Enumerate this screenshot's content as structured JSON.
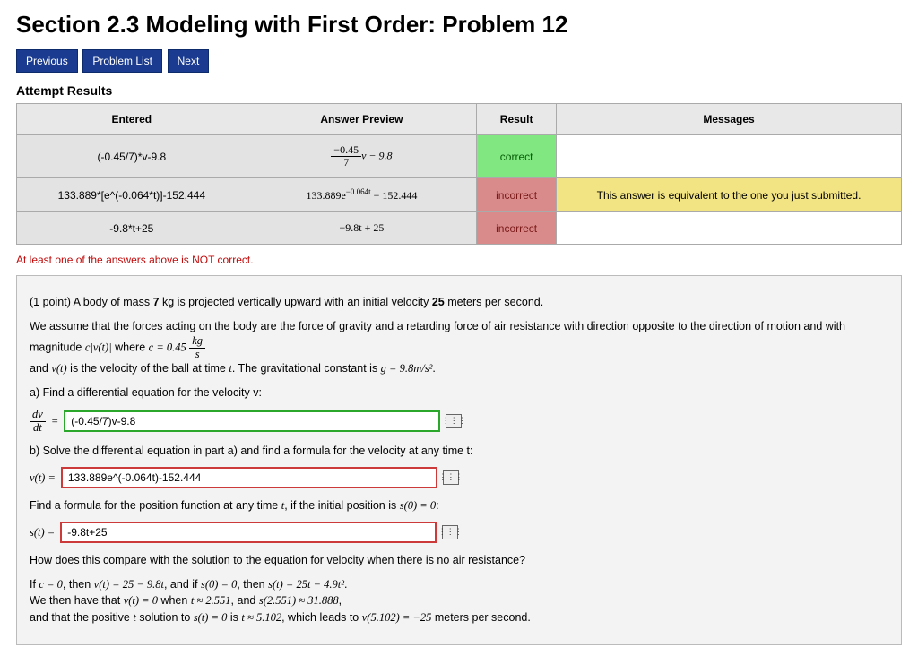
{
  "page_title": "Section 2.3 Modeling with First Order: Problem 12",
  "nav": {
    "prev": "Previous",
    "list": "Problem List",
    "next": "Next"
  },
  "attempt_heading": "Attempt Results",
  "table": {
    "headers": {
      "entered": "Entered",
      "preview": "Answer Preview",
      "result": "Result",
      "messages": "Messages"
    },
    "rows": [
      {
        "entered": "(-0.45/7)*v-9.8",
        "preview_num": "−0.45",
        "preview_den": "7",
        "preview_tail": "v − 9.8",
        "result": "correct",
        "result_class": "res-correct",
        "message": ""
      },
      {
        "entered": "133.889*[e^(-0.064*t)]-152.444",
        "preview_plain": "133.889e",
        "preview_sup": "−0.064t",
        "preview_tail2": " − 152.444",
        "result": "incorrect",
        "result_class": "res-incorrect",
        "message": "This answer is equivalent to the one you just submitted.",
        "msg_class": "msg-warn"
      },
      {
        "entered": "-9.8*t+25",
        "preview_plain2": "−9.8t + 25",
        "result": "incorrect",
        "result_class": "res-incorrect",
        "message": ""
      }
    ]
  },
  "not_correct": "At least one of the answers above is NOT correct.",
  "problem": {
    "points_lead": "(1 point) A body of mass ",
    "mass": "7",
    "points_mid": " kg is projected vertically upward with an initial velocity ",
    "v0": "25",
    "points_tail": " meters per second.",
    "assume_pre": "We assume that the forces acting on the body are the force of gravity and a retarding force of air resistance with direction opposite to the direction of motion and with magnitude ",
    "assume_cvt": "c|v(t)|",
    "assume_where": " where ",
    "assume_cval": "c = 0.45",
    "assume_unit_num": "kg",
    "assume_unit_den": "s",
    "assume_line2a": "and ",
    "assume_vt": "v(t)",
    "assume_line2b": " is the velocity of the ball at time ",
    "assume_t": "t",
    "assume_line2c": ". The gravitational constant is ",
    "assume_g": "g = 9.8m/s²",
    "assume_line2d": ".",
    "a_prompt": "a) Find a differential equation for the velocity v:",
    "a_lhs_num": "dv",
    "a_lhs_den": "dt",
    "a_eq": "=",
    "a_value": "(-0.45/7)v-9.8",
    "b_prompt": "b) Solve the differential equation in part a) and find a formula for the velocity at any time t:",
    "b_lhs": "v(t) =",
    "b_value": "133.889e^(-0.064t)-152.444",
    "c_prompt_pre": "Find a formula for the position function at any time ",
    "c_prompt_mid": ", if the initial position is ",
    "c_prompt_cond": "s(0) = 0",
    "c_prompt_tail": ":",
    "c_lhs": "s(t) =",
    "c_value": "-9.8t+25",
    "compare": "How does this compare with the solution to the equation for velocity when there is no air resistance?",
    "sol1_a": "If ",
    "sol1_c0": "c = 0",
    "sol1_b": ", then ",
    "sol1_vt": "v(t) = 25 − 9.8t",
    "sol1_c": ", and if ",
    "sol1_s0": "s(0) = 0",
    "sol1_d": ", then ",
    "sol1_st": "s(t) = 25t − 4.9t²",
    "sol1_e": ".",
    "sol2_a": "We then have that ",
    "sol2_vt0": "v(t) = 0",
    "sol2_b": " when ",
    "sol2_t1": "t ≈ 2.551",
    "sol2_c": ", and ",
    "sol2_s1": "s(2.551) ≈ 31.888",
    "sol2_d": ",",
    "sol3_a": "and that the positive ",
    "sol3_t": "t",
    "sol3_b": " solution to ",
    "sol3_st0": "s(t) = 0",
    "sol3_c": " is ",
    "sol3_t2": "t ≈ 5.102",
    "sol3_d": ", which leads to ",
    "sol3_v2": "v(5.102) = −25",
    "sol3_e": " meters per second."
  },
  "chart_data": {
    "type": "table",
    "title": "Attempt Results",
    "columns": [
      "Entered",
      "Answer Preview",
      "Result",
      "Messages"
    ],
    "rows": [
      [
        "(-0.45/7)*v-9.8",
        "(-0.45/7) v − 9.8",
        "correct",
        ""
      ],
      [
        "133.889*[e^(-0.064*t)]-152.444",
        "133.889 e^{-0.064t} − 152.444",
        "incorrect",
        "This answer is equivalent to the one you just submitted."
      ],
      [
        "-9.8*t+25",
        "−9.8t + 25",
        "incorrect",
        ""
      ]
    ]
  }
}
